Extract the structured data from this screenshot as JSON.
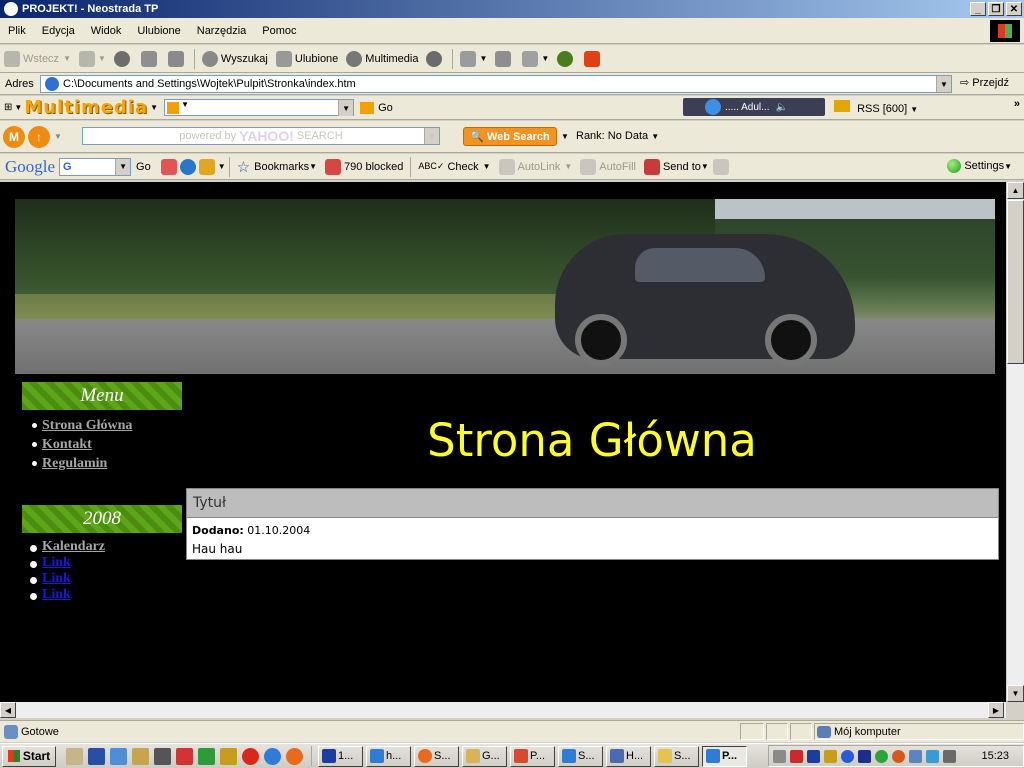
{
  "window": {
    "title": "PROJEKT! - Neostrada TP"
  },
  "menu": [
    "Plik",
    "Edycja",
    "Widok",
    "Ulubione",
    "Narzędzia",
    "Pomoc"
  ],
  "toolbar": {
    "back": "Wstecz",
    "search": "Wyszukaj",
    "favorites": "Ulubione",
    "media": "Multimedia"
  },
  "address": {
    "label": "Adres",
    "url": "C:\\Documents and Settings\\Wojtek\\Pulpit\\Stronka\\index.htm",
    "go": "Przejdź"
  },
  "multimedia_bar": {
    "logo": "Multimedia",
    "go": "Go",
    "player_track": "..... Adul...",
    "rss": "RSS [600]"
  },
  "yahoo_bar": {
    "search_placeholder_prefix": "powered by",
    "search_placeholder_brand": "YAHOO!",
    "search_placeholder_suffix": "SEARCH",
    "web_search": "Web Search",
    "rank": "Rank: No Data"
  },
  "google_bar": {
    "logo": "Google",
    "go": "Go",
    "bookmarks": "Bookmarks",
    "blocked": "790 blocked",
    "check": "Check",
    "autolink": "AutoLink",
    "autofill": "AutoFill",
    "send_to": "Send to",
    "settings": "Settings"
  },
  "page": {
    "title": "Strona Główna",
    "sidebar": {
      "menu_title": "Menu",
      "menu_links": [
        "Strona Główna",
        "Kontakt",
        "Regulamin"
      ],
      "year_title": "2008",
      "year_links": [
        "Kalendarz",
        "Link",
        "Link",
        "Link"
      ]
    },
    "post": {
      "title": "Tytuł",
      "added_label": "Dodano:",
      "added_date": "01.10.2004",
      "body": "Hau hau"
    }
  },
  "status": {
    "text": "Gotowe",
    "zone": "Mój komputer"
  },
  "taskbar": {
    "start": "Start",
    "tasks": [
      "1...",
      "h...",
      "S...",
      "G...",
      "P...",
      "S...",
      "H...",
      "S...",
      "P..."
    ],
    "clock": "15:23"
  }
}
